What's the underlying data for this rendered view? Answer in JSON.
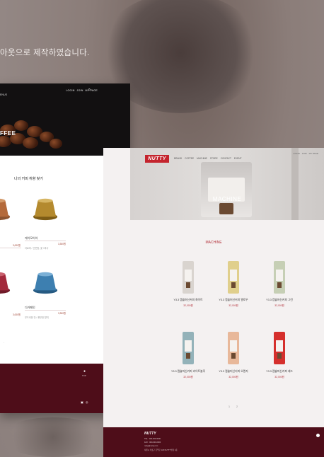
{
  "caption": "아웃으로 제작하였습니다.",
  "left_page": {
    "menus_label": "ENUS",
    "nav": [
      "LOGIN",
      "JOIN",
      "MY PAGE"
    ],
    "search_icon": "search-icon",
    "hero_text": "FFEE",
    "section_title": "나의 커피 취향 찾기",
    "products": [
      {
        "name": "",
        "meta": "",
        "price": "3,000원",
        "color": "#b46a3b"
      },
      {
        "name": "케이모어아",
        "meta": "아로마 / 산뜻함, 꽃 / 화사",
        "price": "3,300원",
        "color": "#b48a2e"
      },
      {
        "name": "",
        "meta": "",
        "price": "3,000원",
        "color": "#a32a3c"
      },
      {
        "name": "디카페인",
        "meta": "부드러운 맛 / 풍부한 향미",
        "price": "3,300원",
        "color": "#3d7fb0"
      }
    ],
    "footer_icons": [
      "youtube-icon",
      "instagram-icon"
    ],
    "footer_top_label": "TOP"
  },
  "right_page": {
    "logo": "NUTTY",
    "nav": [
      "BRAND",
      "COFFEE",
      "MACHINE",
      "STORE",
      "CONTACT",
      "EVENT"
    ],
    "util": [
      "LOGIN",
      "JOIN",
      "MY PAGE"
    ],
    "hero_title": "MACHINE",
    "section_title": "MACHINE",
    "machines": [
      {
        "name": "Y3.3 캡슐머신커피 화이트",
        "price": "32,000원",
        "color": "#d9d4cf"
      },
      {
        "name": "Y3.3 캡슐머신커피 옐로우",
        "price": "32,000원",
        "color": "#e0cf8c"
      },
      {
        "name": "Y3.3 캡슐머신커피 그린",
        "price": "32,000원",
        "color": "#c6cfb5"
      },
      {
        "name": "Y3.3 캡슐머신커피 라이트블루",
        "price": "32,000원",
        "color": "#93b2b9"
      },
      {
        "name": "Y3.3 캡슐머신커피 오렌지",
        "price": "32,000원",
        "color": "#e8b89a"
      },
      {
        "name": "Y3.3 캡슐머신커피 레드",
        "price": "32,000원",
        "color": "#d52f2c"
      }
    ],
    "pager": [
      "1",
      "2"
    ],
    "footer_logo": "NUTTY",
    "footer_lines": [
      "TEL : 000-000-0000",
      "FAX : 000-000-0000",
      "nutty@nutty.com",
      "서울시 마포구 홍익로 123 NUTTY빌딩 1층"
    ]
  },
  "colors": {
    "accent": "#b4333d",
    "footer": "#4e0d19"
  }
}
